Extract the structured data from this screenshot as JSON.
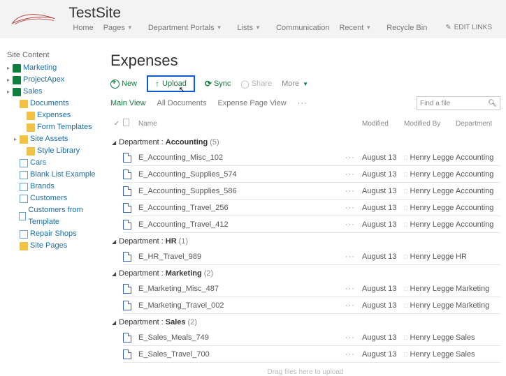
{
  "site": {
    "title": "TestSite"
  },
  "global_nav": {
    "items": [
      {
        "label": "Home",
        "caret": false
      },
      {
        "label": "Pages",
        "caret": true
      },
      {
        "label": "Department Portals",
        "caret": true
      },
      {
        "label": "Lists",
        "caret": true
      },
      {
        "label": "Communication",
        "caret": false
      },
      {
        "label": "Recent",
        "caret": true
      },
      {
        "label": "Recycle Bin",
        "caret": false
      }
    ],
    "edit_links": "EDIT LINKS"
  },
  "sidebar": {
    "title": "Site Content",
    "nodes": [
      {
        "label": "Marketing",
        "icon": "sub",
        "indent": 0,
        "caret": true
      },
      {
        "label": "ProjectApex",
        "icon": "sub",
        "indent": 0,
        "caret": true
      },
      {
        "label": "Sales",
        "icon": "sub",
        "indent": 0,
        "caret": true
      },
      {
        "label": "Documents",
        "icon": "fold",
        "indent": 1,
        "caret": false
      },
      {
        "label": "Expenses",
        "icon": "fold",
        "indent": 2,
        "caret": false
      },
      {
        "label": "Form Templates",
        "icon": "fold",
        "indent": 2,
        "caret": false
      },
      {
        "label": "Site Assets",
        "icon": "fold",
        "indent": 1,
        "caret": true
      },
      {
        "label": "Style Library",
        "icon": "fold",
        "indent": 2,
        "caret": false
      },
      {
        "label": "Cars",
        "icon": "list",
        "indent": 1,
        "caret": false
      },
      {
        "label": "Blank List Example",
        "icon": "list",
        "indent": 1,
        "caret": false
      },
      {
        "label": "Brands",
        "icon": "list",
        "indent": 1,
        "caret": false
      },
      {
        "label": "Customers",
        "icon": "list",
        "indent": 1,
        "caret": false
      },
      {
        "label": "Customers from Template",
        "icon": "list",
        "indent": 1,
        "caret": false
      },
      {
        "label": "Repair Shops",
        "icon": "list",
        "indent": 1,
        "caret": false
      },
      {
        "label": "Site Pages",
        "icon": "fold",
        "indent": 1,
        "caret": false
      }
    ]
  },
  "page": {
    "title": "Expenses"
  },
  "actions": {
    "new": "New",
    "upload": "Upload",
    "sync": "Sync",
    "share": "Share",
    "more": "More"
  },
  "views": {
    "main": "Main View",
    "all": "All Documents",
    "expense_page": "Expense Page View",
    "search_placeholder": "Find a file"
  },
  "columns": {
    "name": "Name",
    "modified": "Modified",
    "modified_by": "Modified By",
    "department": "Department"
  },
  "group_label": "Department",
  "groups": [
    {
      "name": "Accounting",
      "count": 5,
      "rows": [
        {
          "name": "E_Accounting_Misc_102",
          "modified": "August 13",
          "modified_by": "Henry Legge",
          "department": "Accounting"
        },
        {
          "name": "E_Accounting_Supplies_574",
          "modified": "August 13",
          "modified_by": "Henry Legge",
          "department": "Accounting"
        },
        {
          "name": "E_Accounting_Supplies_586",
          "modified": "August 13",
          "modified_by": "Henry Legge",
          "department": "Accounting"
        },
        {
          "name": "E_Accounting_Travel_256",
          "modified": "August 13",
          "modified_by": "Henry Legge",
          "department": "Accounting"
        },
        {
          "name": "E_Accounting_Travel_412",
          "modified": "August 13",
          "modified_by": "Henry Legge",
          "department": "Accounting"
        }
      ]
    },
    {
      "name": "HR",
      "count": 1,
      "rows": [
        {
          "name": "E_HR_Travel_989",
          "modified": "August 13",
          "modified_by": "Henry Legge",
          "department": "HR"
        }
      ]
    },
    {
      "name": "Marketing",
      "count": 2,
      "rows": [
        {
          "name": "E_Marketing_Misc_487",
          "modified": "August 13",
          "modified_by": "Henry Legge",
          "department": "Marketing"
        },
        {
          "name": "E_Marketing_Travel_002",
          "modified": "August 13",
          "modified_by": "Henry Legge",
          "department": "Marketing"
        }
      ]
    },
    {
      "name": "Sales",
      "count": 2,
      "rows": [
        {
          "name": "E_Sales_Meals_749",
          "modified": "August 13",
          "modified_by": "Henry Legge",
          "department": "Sales"
        },
        {
          "name": "E_Sales_Travel_700",
          "modified": "August 13",
          "modified_by": "Henry Legge",
          "department": "Sales"
        }
      ]
    }
  ],
  "drag_hint": "Drag files here to upload"
}
